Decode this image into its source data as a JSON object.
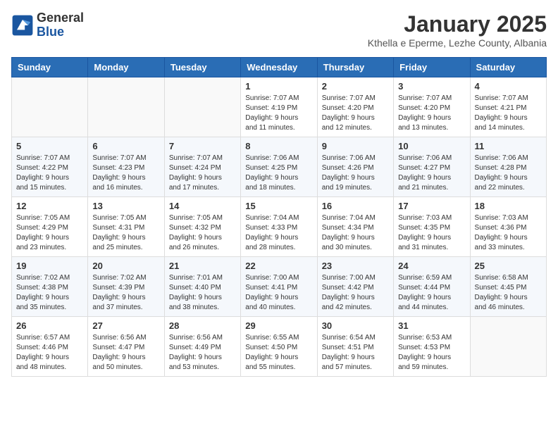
{
  "logo": {
    "general": "General",
    "blue": "Blue"
  },
  "header": {
    "month": "January 2025",
    "location": "Kthella e Eperme, Lezhe County, Albania"
  },
  "weekdays": [
    "Sunday",
    "Monday",
    "Tuesday",
    "Wednesday",
    "Thursday",
    "Friday",
    "Saturday"
  ],
  "weeks": [
    [
      {
        "day": "",
        "info": ""
      },
      {
        "day": "",
        "info": ""
      },
      {
        "day": "",
        "info": ""
      },
      {
        "day": "1",
        "info": "Sunrise: 7:07 AM\nSunset: 4:19 PM\nDaylight: 9 hours\nand 11 minutes."
      },
      {
        "day": "2",
        "info": "Sunrise: 7:07 AM\nSunset: 4:20 PM\nDaylight: 9 hours\nand 12 minutes."
      },
      {
        "day": "3",
        "info": "Sunrise: 7:07 AM\nSunset: 4:20 PM\nDaylight: 9 hours\nand 13 minutes."
      },
      {
        "day": "4",
        "info": "Sunrise: 7:07 AM\nSunset: 4:21 PM\nDaylight: 9 hours\nand 14 minutes."
      }
    ],
    [
      {
        "day": "5",
        "info": "Sunrise: 7:07 AM\nSunset: 4:22 PM\nDaylight: 9 hours\nand 15 minutes."
      },
      {
        "day": "6",
        "info": "Sunrise: 7:07 AM\nSunset: 4:23 PM\nDaylight: 9 hours\nand 16 minutes."
      },
      {
        "day": "7",
        "info": "Sunrise: 7:07 AM\nSunset: 4:24 PM\nDaylight: 9 hours\nand 17 minutes."
      },
      {
        "day": "8",
        "info": "Sunrise: 7:06 AM\nSunset: 4:25 PM\nDaylight: 9 hours\nand 18 minutes."
      },
      {
        "day": "9",
        "info": "Sunrise: 7:06 AM\nSunset: 4:26 PM\nDaylight: 9 hours\nand 19 minutes."
      },
      {
        "day": "10",
        "info": "Sunrise: 7:06 AM\nSunset: 4:27 PM\nDaylight: 9 hours\nand 21 minutes."
      },
      {
        "day": "11",
        "info": "Sunrise: 7:06 AM\nSunset: 4:28 PM\nDaylight: 9 hours\nand 22 minutes."
      }
    ],
    [
      {
        "day": "12",
        "info": "Sunrise: 7:05 AM\nSunset: 4:29 PM\nDaylight: 9 hours\nand 23 minutes."
      },
      {
        "day": "13",
        "info": "Sunrise: 7:05 AM\nSunset: 4:31 PM\nDaylight: 9 hours\nand 25 minutes."
      },
      {
        "day": "14",
        "info": "Sunrise: 7:05 AM\nSunset: 4:32 PM\nDaylight: 9 hours\nand 26 minutes."
      },
      {
        "day": "15",
        "info": "Sunrise: 7:04 AM\nSunset: 4:33 PM\nDaylight: 9 hours\nand 28 minutes."
      },
      {
        "day": "16",
        "info": "Sunrise: 7:04 AM\nSunset: 4:34 PM\nDaylight: 9 hours\nand 30 minutes."
      },
      {
        "day": "17",
        "info": "Sunrise: 7:03 AM\nSunset: 4:35 PM\nDaylight: 9 hours\nand 31 minutes."
      },
      {
        "day": "18",
        "info": "Sunrise: 7:03 AM\nSunset: 4:36 PM\nDaylight: 9 hours\nand 33 minutes."
      }
    ],
    [
      {
        "day": "19",
        "info": "Sunrise: 7:02 AM\nSunset: 4:38 PM\nDaylight: 9 hours\nand 35 minutes."
      },
      {
        "day": "20",
        "info": "Sunrise: 7:02 AM\nSunset: 4:39 PM\nDaylight: 9 hours\nand 37 minutes."
      },
      {
        "day": "21",
        "info": "Sunrise: 7:01 AM\nSunset: 4:40 PM\nDaylight: 9 hours\nand 38 minutes."
      },
      {
        "day": "22",
        "info": "Sunrise: 7:00 AM\nSunset: 4:41 PM\nDaylight: 9 hours\nand 40 minutes."
      },
      {
        "day": "23",
        "info": "Sunrise: 7:00 AM\nSunset: 4:42 PM\nDaylight: 9 hours\nand 42 minutes."
      },
      {
        "day": "24",
        "info": "Sunrise: 6:59 AM\nSunset: 4:44 PM\nDaylight: 9 hours\nand 44 minutes."
      },
      {
        "day": "25",
        "info": "Sunrise: 6:58 AM\nSunset: 4:45 PM\nDaylight: 9 hours\nand 46 minutes."
      }
    ],
    [
      {
        "day": "26",
        "info": "Sunrise: 6:57 AM\nSunset: 4:46 PM\nDaylight: 9 hours\nand 48 minutes."
      },
      {
        "day": "27",
        "info": "Sunrise: 6:56 AM\nSunset: 4:47 PM\nDaylight: 9 hours\nand 50 minutes."
      },
      {
        "day": "28",
        "info": "Sunrise: 6:56 AM\nSunset: 4:49 PM\nDaylight: 9 hours\nand 53 minutes."
      },
      {
        "day": "29",
        "info": "Sunrise: 6:55 AM\nSunset: 4:50 PM\nDaylight: 9 hours\nand 55 minutes."
      },
      {
        "day": "30",
        "info": "Sunrise: 6:54 AM\nSunset: 4:51 PM\nDaylight: 9 hours\nand 57 minutes."
      },
      {
        "day": "31",
        "info": "Sunrise: 6:53 AM\nSunset: 4:53 PM\nDaylight: 9 hours\nand 59 minutes."
      },
      {
        "day": "",
        "info": ""
      }
    ]
  ]
}
